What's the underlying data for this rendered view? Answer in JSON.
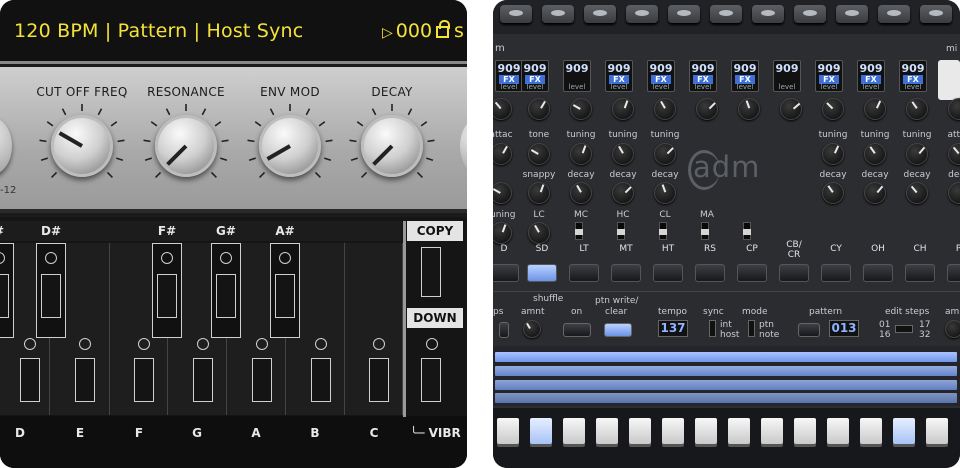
{
  "left": {
    "lcd": {
      "text": "120 BPM | Pattern | Host Sync",
      "play_glyph": "▷",
      "counter": "000",
      "edge": "s"
    },
    "knobs": [
      {
        "label": "CUT OFF FREQ",
        "angle": 120
      },
      {
        "label": "RESONANCE",
        "angle": 45
      },
      {
        "label": "ENV MOD",
        "angle": 60
      },
      {
        "label": "DECAY",
        "angle": 45
      }
    ],
    "range_label": "-12",
    "black_notes": [
      "#",
      "D#",
      "F#",
      "G#",
      "A#"
    ],
    "white_notes": [
      "D",
      "E",
      "F",
      "G",
      "A",
      "B",
      "C"
    ],
    "buttons": {
      "copy": "COPY",
      "down": "DOWN"
    },
    "vibr_label": "VIBR"
  },
  "right": {
    "title_fragment": "m",
    "fx_badges": [
      {
        "num": "909",
        "fx": "FX",
        "lvl": "level"
      },
      {
        "num": "909",
        "fx": "FX",
        "lvl": "level"
      },
      {
        "num": "909",
        "fx": "",
        "lvl": "level"
      },
      {
        "num": "909",
        "fx": "FX",
        "lvl": "level"
      },
      {
        "num": "909",
        "fx": "FX",
        "lvl": "level"
      },
      {
        "num": "909",
        "fx": "FX",
        "lvl": "level"
      },
      {
        "num": "909",
        "fx": "FX",
        "lvl": "level"
      },
      {
        "num": "909",
        "fx": "",
        "lvl": "level"
      },
      {
        "num": "909",
        "fx": "FX",
        "lvl": "level"
      },
      {
        "num": "909",
        "fx": "FX",
        "lvl": "level"
      },
      {
        "num": "909",
        "fx": "FX",
        "lvl": "level"
      }
    ],
    "side_label": "mi",
    "row2_labels": [
      "attac",
      "tone",
      "tuning",
      "tuning",
      "tuning",
      "",
      "",
      "",
      "tuning",
      "tuning",
      "tuning",
      "attac"
    ],
    "row3_labels": [
      "",
      "snappy",
      "decay",
      "decay",
      "decay",
      "",
      "",
      "",
      "decay",
      "decay",
      "decay",
      "deca"
    ],
    "row4_labels": [
      "tuning",
      "LC",
      "MC",
      "HC",
      "CL",
      "MA"
    ],
    "logo": "adm",
    "instruments": [
      "D",
      "SD",
      "LT",
      "MT",
      "HT",
      "RS",
      "CP",
      "CB/\nCR",
      "CY",
      "OH",
      "CH",
      "PD"
    ],
    "controls": {
      "shuffle": "shuffle",
      "amnt": "amnt",
      "on": "on",
      "ptn_write": "ptn write/",
      "clear": "clear",
      "tempo": "tempo",
      "tempo_value": "137",
      "sync": "sync",
      "int": "int",
      "host": "host",
      "mode": "mode",
      "ptn": "ptn",
      "note": "note",
      "pattern": "pattern",
      "pattern_value": "013",
      "edit_steps": "edit steps",
      "s01": "01",
      "s16": "16",
      "s17": "17",
      "s32": "32",
      "ps": "ps",
      "amnt_right": "amn"
    }
  }
}
